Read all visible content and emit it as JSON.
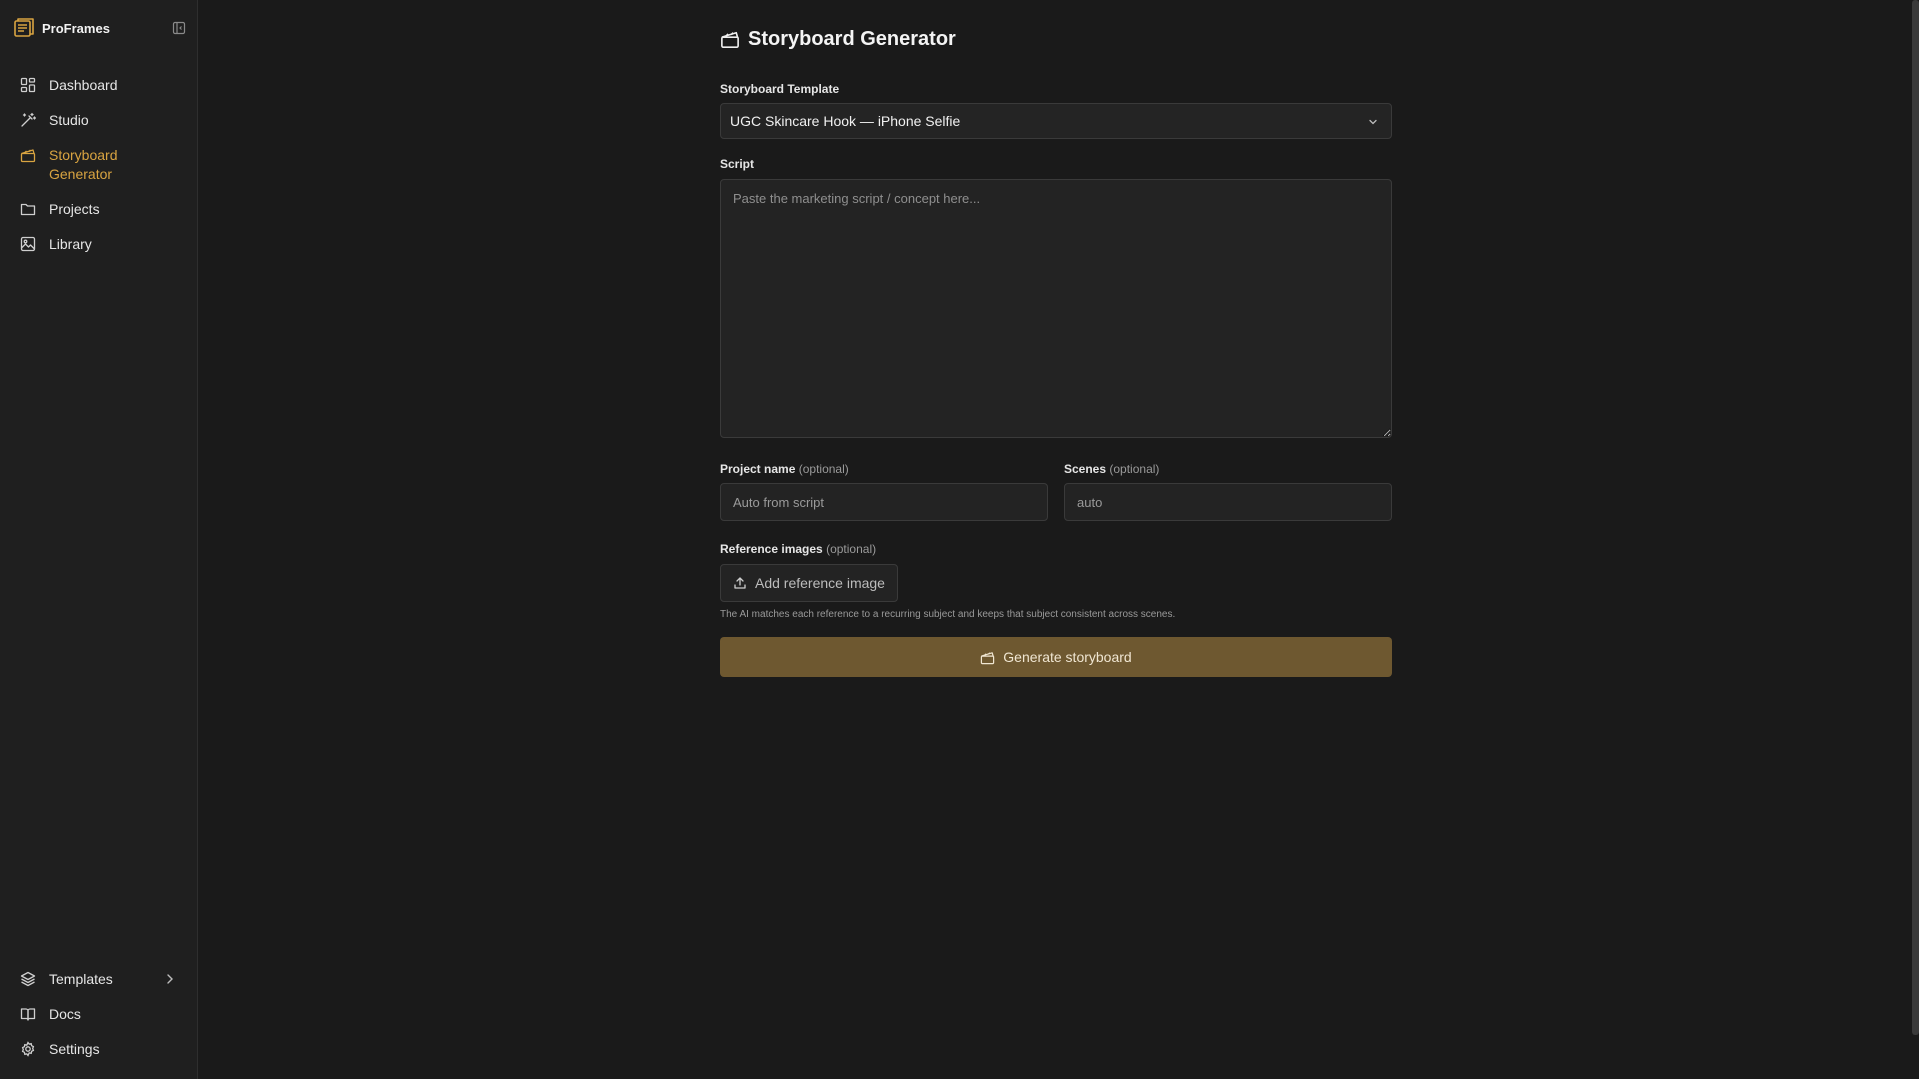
{
  "brand": {
    "name": "ProFrames",
    "accent": "#d9a441"
  },
  "sidebar": {
    "items": [
      {
        "label": "Dashboard",
        "icon": "dashboard-icon"
      },
      {
        "label": "Studio",
        "icon": "wand-icon"
      },
      {
        "label": "Storyboard Generator",
        "icon": "clapperboard-icon",
        "active": true
      },
      {
        "label": "Projects",
        "icon": "folder-icon"
      },
      {
        "label": "Library",
        "icon": "image-icon"
      }
    ],
    "bottom": [
      {
        "label": "Templates",
        "icon": "layers-icon"
      },
      {
        "label": "Docs",
        "icon": "book-icon"
      },
      {
        "label": "Settings",
        "icon": "gear-icon"
      }
    ]
  },
  "page": {
    "title": "Storyboard Generator"
  },
  "form": {
    "template_label": "Storyboard Template",
    "template_value": "UGC Skincare Hook — iPhone Selfie",
    "script_label": "Script",
    "script_placeholder": "Paste the marketing script / concept here...",
    "project_label": "Project name",
    "project_optional": "(optional)",
    "project_placeholder": "Auto from script",
    "scenes_label": "Scenes",
    "scenes_optional": "(optional)",
    "scenes_placeholder": "auto",
    "refs_label": "Reference images",
    "refs_optional": "(optional)",
    "add_ref_label": "Add reference image",
    "hint": "The AI matches each reference to a recurring subject and keeps that subject consistent across scenes.",
    "generate_label": "Generate storyboard"
  }
}
